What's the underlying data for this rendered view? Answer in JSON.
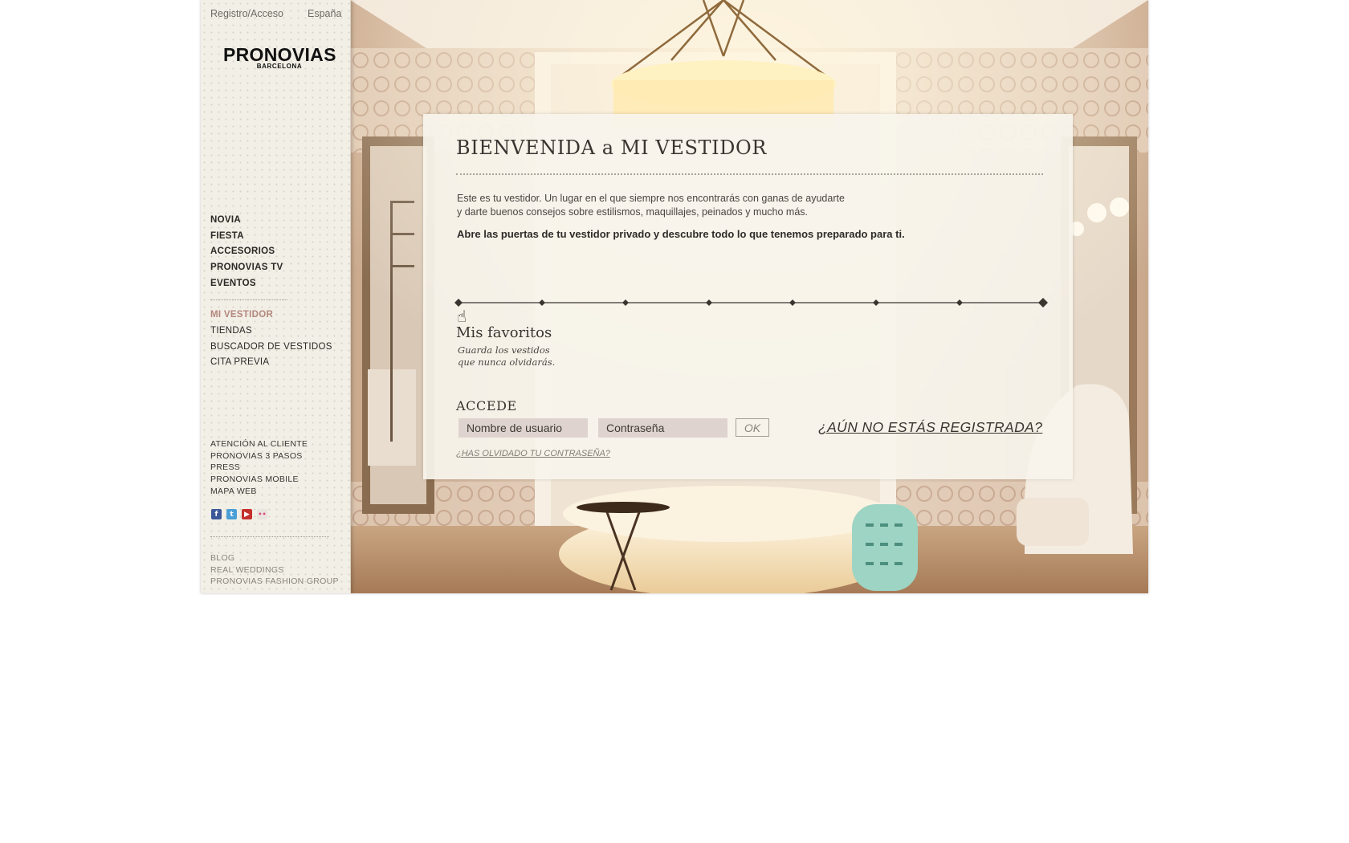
{
  "topbar": {
    "login_label": "Registro/Acceso",
    "country_label": "España"
  },
  "logo": {
    "brand": "PRONOVIAS",
    "city": "BARCELONA"
  },
  "main_nav": [
    "NOVIA",
    "FIESTA",
    "ACCESORIOS",
    "PRONOVIAS TV",
    "EVENTOS"
  ],
  "secondary_nav": {
    "active": "MI VESTIDOR",
    "items": [
      "TIENDAS",
      "BUSCADOR DE VESTIDOS",
      "CITA PREVIA"
    ]
  },
  "footer_links": [
    "ATENCIÓN AL CLIENTE",
    "PRONOVIAS 3 PASOS",
    "PRESS",
    "PRONOVIAS MOBILE",
    "MAPA WEB"
  ],
  "social": [
    {
      "icon": "facebook-icon",
      "glyph": "f",
      "color": "#3b5998"
    },
    {
      "icon": "twitter-icon",
      "glyph": "t",
      "color": "#4a9fd6"
    },
    {
      "icon": "youtube-icon",
      "glyph": "▶",
      "color": "#c4302b"
    },
    {
      "icon": "flickr-icon",
      "glyph": "••",
      "color": "#e9e4de"
    }
  ],
  "extra_links": [
    "BLOG",
    "REAL WEDDINGS",
    "PRONOVIAS FASHION GROUP"
  ],
  "panel": {
    "title": "BIENVENIDA a MI VESTIDOR",
    "intro_line1": "Este es tu vestidor. Un lugar en el que siempre nos encontrarás con ganas de ayudarte",
    "intro_line2": "y darte buenos consejos sobre estilismos, maquillajes, peinados y mucho más.",
    "intro_bold": "Abre las puertas de tu vestidor privado y descubre todo lo que tenemos preparado para ti.",
    "steps_total": 8,
    "current_step": 1,
    "step_title": "Mis favoritos",
    "step_subtitle_1": "Guarda los vestidos",
    "step_subtitle_2": "que nunca olvidarás.",
    "login_heading": "ACCEDE",
    "username_placeholder": "Nombre de usuario",
    "password_placeholder": "Contraseña",
    "ok_label": "OK",
    "forgot_label": "¿HAS OLVIDADO TU CONTRASEÑA?",
    "register_label": "¿AÚN NO ESTÁS REGISTRADA?"
  },
  "colors": {
    "accent_active": "#b3877c",
    "sidebar_bg": "#f2efe7",
    "panel_bg": "#f7f4ec"
  }
}
